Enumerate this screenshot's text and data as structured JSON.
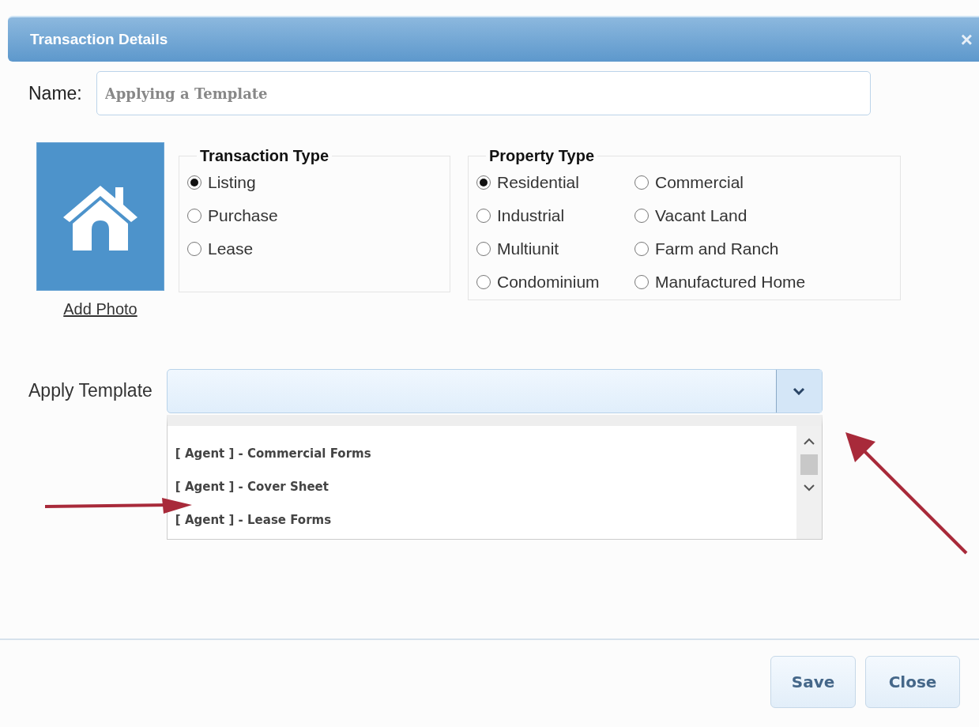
{
  "dialog": {
    "title": "Transaction Details",
    "close": "×"
  },
  "name_field": {
    "label": "Name:",
    "value": "Applying a Template"
  },
  "photo": {
    "link": "Add Photo"
  },
  "transaction_type": {
    "legend": "Transaction Type",
    "options": [
      {
        "label": "Listing",
        "selected": true
      },
      {
        "label": "Purchase",
        "selected": false
      },
      {
        "label": "Lease",
        "selected": false
      }
    ]
  },
  "property_type": {
    "legend": "Property Type",
    "options": [
      {
        "label": "Residential",
        "selected": true
      },
      {
        "label": "Commercial",
        "selected": false
      },
      {
        "label": "Industrial",
        "selected": false
      },
      {
        "label": "Vacant Land",
        "selected": false
      },
      {
        "label": "Multiunit",
        "selected": false
      },
      {
        "label": "Farm and Ranch",
        "selected": false
      },
      {
        "label": "Condominium",
        "selected": false
      },
      {
        "label": "Manufactured Home",
        "selected": false
      }
    ]
  },
  "apply_template": {
    "label": "Apply Template",
    "expanded": true,
    "options": [
      "[ Agent ] - Commercial Forms",
      "[ Agent ] - Cover Sheet",
      "[ Agent ] - Lease Forms"
    ]
  },
  "buttons": [
    "Save",
    "Close"
  ]
}
